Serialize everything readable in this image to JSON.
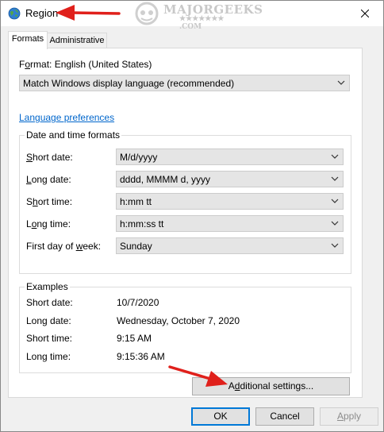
{
  "window": {
    "title": "Region",
    "icon": "globe-icon",
    "close_icon": "close-icon"
  },
  "watermark": {
    "main": "MAJORGEEKS",
    "sub": "★★★★★★★ .COM"
  },
  "tabs": [
    {
      "label": "Formats",
      "active": true
    },
    {
      "label": "Administrative",
      "active": false
    }
  ],
  "format": {
    "label_pre": "F",
    "label_acc": "o",
    "label_post": "rmat: English (United States)",
    "value": "Match Windows display language (recommended)"
  },
  "language_preferences_link": "Language preferences",
  "date_time_formats": {
    "title": "Date and time formats",
    "rows": [
      {
        "pre": "",
        "acc": "S",
        "post": "hort date:",
        "value": "M/d/yyyy"
      },
      {
        "pre": "",
        "acc": "L",
        "post": "ong date:",
        "value": "dddd, MMMM d, yyyy"
      },
      {
        "pre": "S",
        "acc": "h",
        "post": "ort time:",
        "value": "h:mm tt"
      },
      {
        "pre": "L",
        "acc": "o",
        "post": "ng time:",
        "value": "h:mm:ss tt"
      },
      {
        "pre": "First day of ",
        "acc": "w",
        "post": "eek:",
        "value": "Sunday"
      }
    ]
  },
  "examples": {
    "title": "Examples",
    "rows": [
      {
        "label": "Short date:",
        "value": "10/7/2020"
      },
      {
        "label": "Long date:",
        "value": "Wednesday, October 7, 2020"
      },
      {
        "label": "Short time:",
        "value": "9:15 AM"
      },
      {
        "label": "Long time:",
        "value": "9:15:36 AM"
      }
    ]
  },
  "additional_settings": {
    "pre": "A",
    "acc": "d",
    "post": "ditional settings..."
  },
  "footer": {
    "ok": "OK",
    "cancel": "Cancel",
    "apply_acc": "A",
    "apply_post": "pply"
  },
  "colors": {
    "annotation_arrow": "#e0201b",
    "link": "#0066cc",
    "default_button_border": "#0078d7"
  }
}
